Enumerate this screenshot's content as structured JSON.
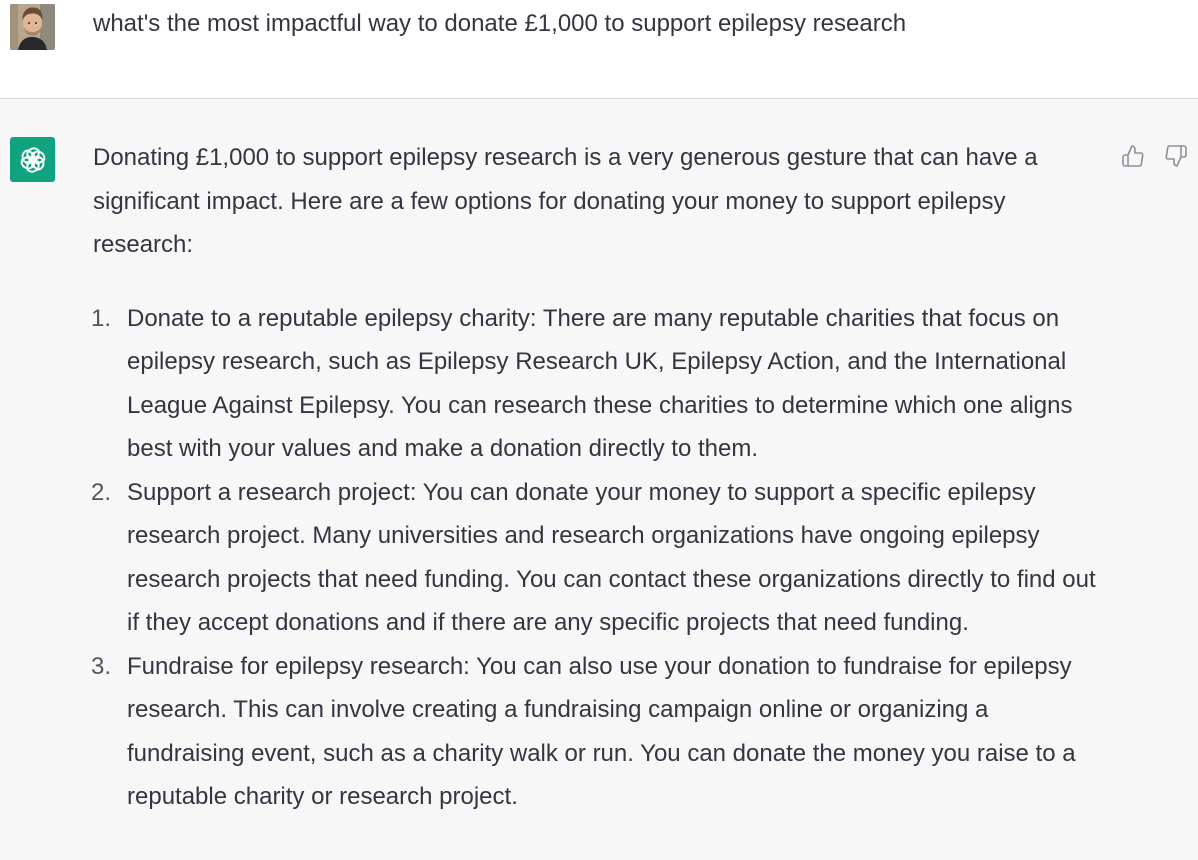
{
  "user_message": {
    "text": "what's the most impactful way to donate £1,000 to support epilepsy research",
    "avatar": "user-photo-avatar"
  },
  "assistant_message": {
    "avatar": "openai-logo-icon",
    "intro": "Donating £1,000 to support epilepsy research is a very generous gesture that can have a significant impact. Here are a few options for donating your money to support epilepsy research:",
    "items": [
      {
        "number": "1.",
        "text": "Donate to a reputable epilepsy charity: There are many reputable charities that focus on epilepsy research, such as Epilepsy Research UK, Epilepsy Action, and the International League Against Epilepsy. You can research these charities to determine which one aligns best with your values and make a donation directly to them."
      },
      {
        "number": "2.",
        "text": "Support a research project: You can donate your money to support a specific epilepsy research project. Many universities and research organizations have ongoing epilepsy research projects that need funding. You can contact these organizations directly to find out if they accept donations and if there are any specific projects that need funding."
      },
      {
        "number": "3.",
        "text": "Fundraise for epilepsy research: You can also use your donation to fundraise for epilepsy research. This can involve creating a fundraising campaign online or organizing a fundraising event, such as a charity walk or run. You can donate the money you raise to a reputable charity or research project."
      }
    ],
    "feedback_icons": [
      "thumbs-up-icon",
      "thumbs-down-icon"
    ]
  },
  "colors": {
    "assistant_bg": "#f7f7f8",
    "brand_green": "#10a37f",
    "text": "#343541"
  }
}
